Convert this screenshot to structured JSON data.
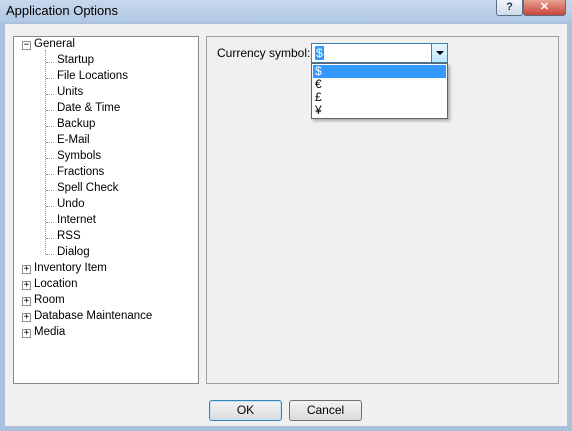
{
  "window": {
    "title": "Application Options",
    "help_button": "?",
    "close_button": "✕"
  },
  "tree": {
    "general": {
      "label": "General",
      "expander": "−",
      "children": [
        "Startup",
        "File Locations",
        "Units",
        "Date & Time",
        "Backup",
        "E-Mail",
        "Symbols",
        "Fractions",
        "Spell Check",
        "Undo",
        "Internet",
        "RSS",
        "Dialog"
      ]
    },
    "others": [
      {
        "label": "Inventory Item",
        "expander": "+"
      },
      {
        "label": "Location",
        "expander": "+"
      },
      {
        "label": "Room",
        "expander": "+"
      },
      {
        "label": "Database Maintenance",
        "expander": "+"
      },
      {
        "label": "Media",
        "expander": "+"
      }
    ]
  },
  "panel": {
    "currency_label": "Currency symbol:",
    "selected_value": "$",
    "options": [
      "$",
      "€",
      "£",
      "¥"
    ],
    "highlighted_index": 0
  },
  "buttons": {
    "ok": "OK",
    "cancel": "Cancel"
  },
  "colors": {
    "selection": "#3399ff",
    "frame": "#a9c1dc"
  }
}
